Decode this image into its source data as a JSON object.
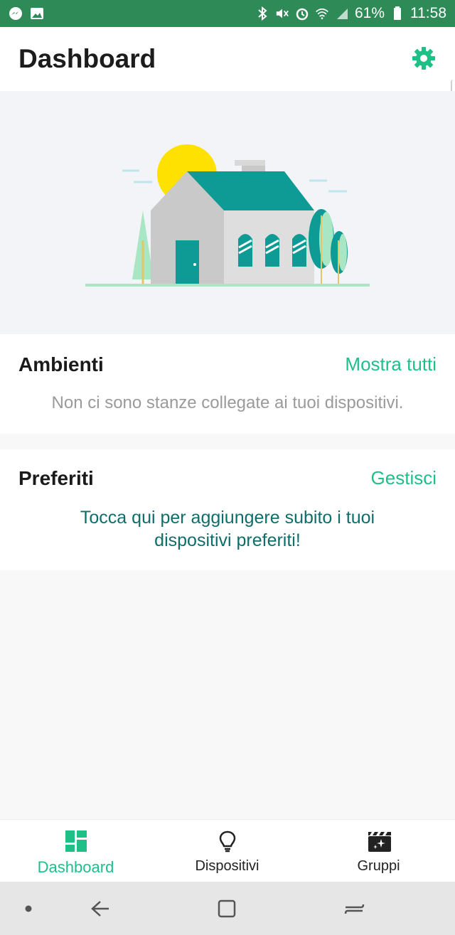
{
  "status_bar": {
    "battery": "61%",
    "time": "11:58",
    "icons": [
      "messenger-icon",
      "gallery-icon",
      "bluetooth-icon",
      "mute-icon",
      "alarm-icon",
      "wifi-icon",
      "signal-icon",
      "battery-icon"
    ]
  },
  "header": {
    "title": "Dashboard",
    "settings_icon": "gear-icon"
  },
  "ambienti": {
    "title": "Ambienti",
    "action": "Mostra tutti",
    "empty": "Non ci sono stanze collegate ai tuoi dispositivi."
  },
  "preferiti": {
    "title": "Preferiti",
    "action": "Gestisci",
    "prompt": "Tocca qui per aggiungere subito i tuoi dispositivi preferiti!"
  },
  "bottom_nav": {
    "items": [
      {
        "label": "Dashboard",
        "icon": "grid-icon",
        "active": true
      },
      {
        "label": "Dispositivi",
        "icon": "lightbulb-icon",
        "active": false
      },
      {
        "label": "Gruppi",
        "icon": "clapperboard-icon",
        "active": false
      }
    ]
  },
  "colors": {
    "status_bar": "#2e8b57",
    "accent": "#1fbf88",
    "teal_text": "#0d6e6a",
    "house_roof": "#0f9b95"
  }
}
